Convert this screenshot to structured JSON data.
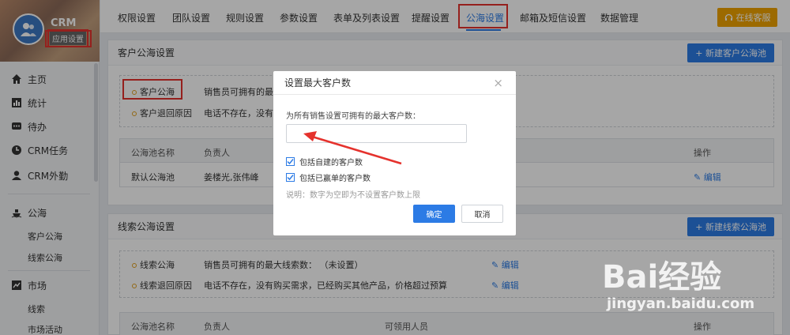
{
  "sidebar": {
    "app_title": "CRM",
    "app_subtitle": "应用设置",
    "items": [
      {
        "label": "主页",
        "icon": "home-icon"
      },
      {
        "label": "统计",
        "icon": "bar-chart-icon"
      },
      {
        "label": "待办",
        "icon": "chat-icon"
      },
      {
        "label": "CRM任务",
        "icon": "clock-icon"
      },
      {
        "label": "CRM外勤",
        "icon": "user-icon"
      }
    ],
    "sections": [
      {
        "label": "公海",
        "icon": "ship-icon",
        "children": [
          "客户公海",
          "线索公海"
        ]
      },
      {
        "label": "市场",
        "icon": "trend-icon",
        "children": [
          "线索",
          "市场活动"
        ]
      }
    ]
  },
  "tabs": [
    "权限设置",
    "团队设置",
    "规则设置",
    "参数设置",
    "表单及列表设置",
    "提醒设置",
    "公海设置",
    "邮箱及短信设置",
    "数据管理"
  ],
  "active_tab": "公海设置",
  "service_button": "在线客服",
  "customer_pool": {
    "title": "客户公海设置",
    "new_button": "+ 新建客户公海池",
    "rows": [
      {
        "label": "客户公海",
        "text": "销售员可拥有的最大"
      },
      {
        "label": "客户退回原因",
        "text": "电话不存在，没有购买"
      }
    ],
    "table_headers": [
      "公海池名称",
      "负责人",
      "操作"
    ],
    "table_rows": [
      {
        "name": "默认公海池",
        "owner": "姜楼光,张伟峰",
        "action": "编辑"
      }
    ]
  },
  "lead_pool": {
    "title": "线索公海设置",
    "new_button": "+ 新建线索公海池",
    "rows": [
      {
        "label": "线索公海",
        "text": "销售员可拥有的最大线索数： （未设置）",
        "action": "编辑"
      },
      {
        "label": "线索退回原因",
        "text": "电话不存在，没有购买需求，已经购买其他产品，价格超过预算",
        "action": "编辑"
      }
    ],
    "table_headers": [
      "公海池名称",
      "负责人",
      "可领用人员",
      "操作"
    ]
  },
  "modal": {
    "title": "设置最大客户数",
    "prompt": "为所有销售设置可拥有的最大客户数：",
    "input_value": "",
    "checkbox_1": "包括自建的客户数",
    "checkbox_2": "包括已赢单的客户数",
    "note": "说明：数字为空即为不设置客户数上限",
    "ok": "确定",
    "cancel": "取消"
  },
  "watermark": {
    "brand": "Bai经验",
    "url": "jingyan.baidu.com"
  },
  "colors": {
    "accent": "#2c7be5",
    "service": "#f0a400",
    "highlight": "#e5322d"
  }
}
